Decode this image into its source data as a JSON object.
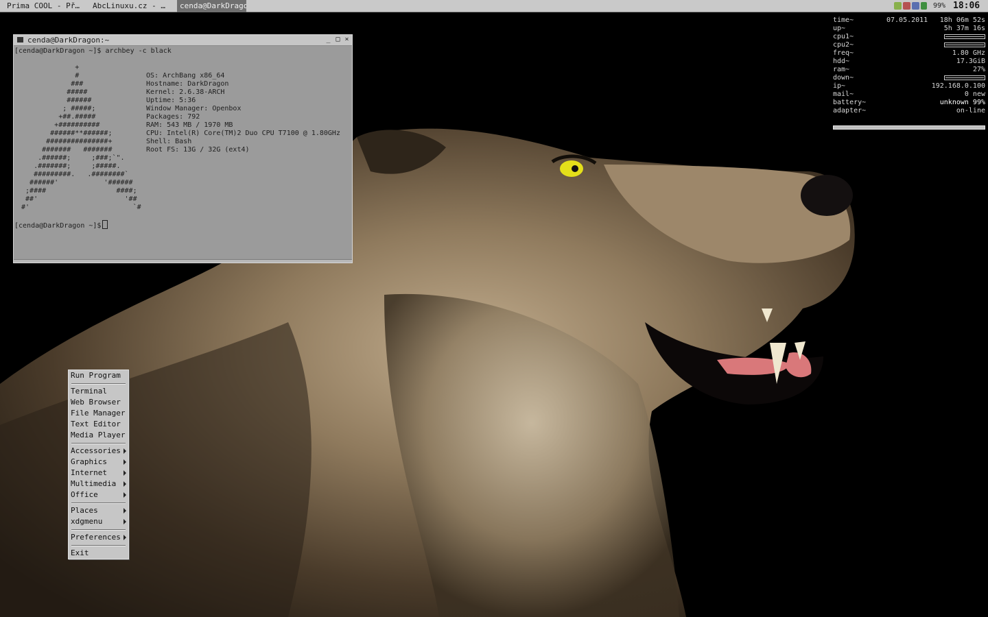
{
  "taskbar": {
    "tasks": [
      {
        "label": "Prima COOL - Př…",
        "active": false
      },
      {
        "label": "AbcLinuxu.cz - …",
        "active": false
      },
      {
        "label": "cenda@DarkDrago…",
        "active": true
      }
    ],
    "battery_text": "99%",
    "clock": "18:06"
  },
  "terminal": {
    "title": "cenda@DarkDragon:~",
    "command_line": "[cenda@DarkDragon ~]$ archbey -c black",
    "logo_lines": [
      "              +",
      "              #",
      "             ###",
      "            #####",
      "            ######",
      "           ; #####;",
      "          +##.#####",
      "         +##########",
      "        ######**######;",
      "       ###############+",
      "      #######   #######",
      "     .######;     ;###;`\".",
      "    .#######;     ;#####.",
      "    #########.   .########`",
      "   ######'           '######",
      "  ;####                 ####;",
      "  ##'                     '##",
      " #'                         `#"
    ],
    "info_lines": [
      "OS: ArchBang x86_64",
      "Hostname: DarkDragon",
      "Kernel: 2.6.38-ARCH",
      "Uptime: 5:36",
      "Window Manager: Openbox",
      "Packages: 792",
      "RAM: 543 MB / 1970 MB",
      "CPU: Intel(R) Core(TM)2 Duo CPU T7100 @ 1.80GHz",
      "Shell: Bash",
      "Root FS: 13G / 32G (ext4)"
    ],
    "prompt": "[cenda@DarkDragon ~]$"
  },
  "conky": {
    "rows": [
      {
        "label": "time~",
        "mid": "07.05.2011",
        "value": "18h 06m 52s"
      },
      {
        "label": "up~",
        "value": "5h 37m 16s"
      },
      {
        "label": "cpu1~",
        "graph": true
      },
      {
        "label": "cpu2~",
        "graph": true
      },
      {
        "label": "freq~",
        "value": "1.80 GHz"
      },
      {
        "label": "hdd~",
        "value": "17.3GiB"
      },
      {
        "label": "ram~",
        "value": "27%"
      },
      {
        "label": "down~",
        "graph": true
      },
      {
        "label": "ip~",
        "value": "192.168.0.100"
      },
      {
        "label": "mail~",
        "value": "0 new"
      },
      {
        "label": "battery~",
        "value": "unknown 99%",
        "strong": true
      },
      {
        "label": "adapter~",
        "value": "on-line"
      }
    ]
  },
  "menu": {
    "items": [
      {
        "label": "Run Program",
        "submenu": false
      },
      {
        "label": "Terminal",
        "submenu": false
      },
      {
        "label": "Web Browser",
        "submenu": false
      },
      {
        "label": "File Manager",
        "submenu": false
      },
      {
        "label": "Text Editor",
        "submenu": false
      },
      {
        "label": "Media Player",
        "submenu": false
      },
      {
        "label": "Accessories",
        "submenu": true
      },
      {
        "label": "Graphics",
        "submenu": true
      },
      {
        "label": "Internet",
        "submenu": true
      },
      {
        "label": "Multimedia",
        "submenu": true
      },
      {
        "label": "Office",
        "submenu": true
      },
      {
        "label": "Places",
        "submenu": true
      },
      {
        "label": "xdgmenu",
        "submenu": true
      },
      {
        "label": "Preferences",
        "submenu": true
      },
      {
        "label": "Exit",
        "submenu": false
      }
    ]
  },
  "colors": {
    "desktop_bg": "#000000",
    "wolf_fur_light": "#b9a58a",
    "wolf_fur_dark": "#3d3224",
    "wolf_eye": "#e4df1a",
    "tongue": "#d9787a"
  }
}
